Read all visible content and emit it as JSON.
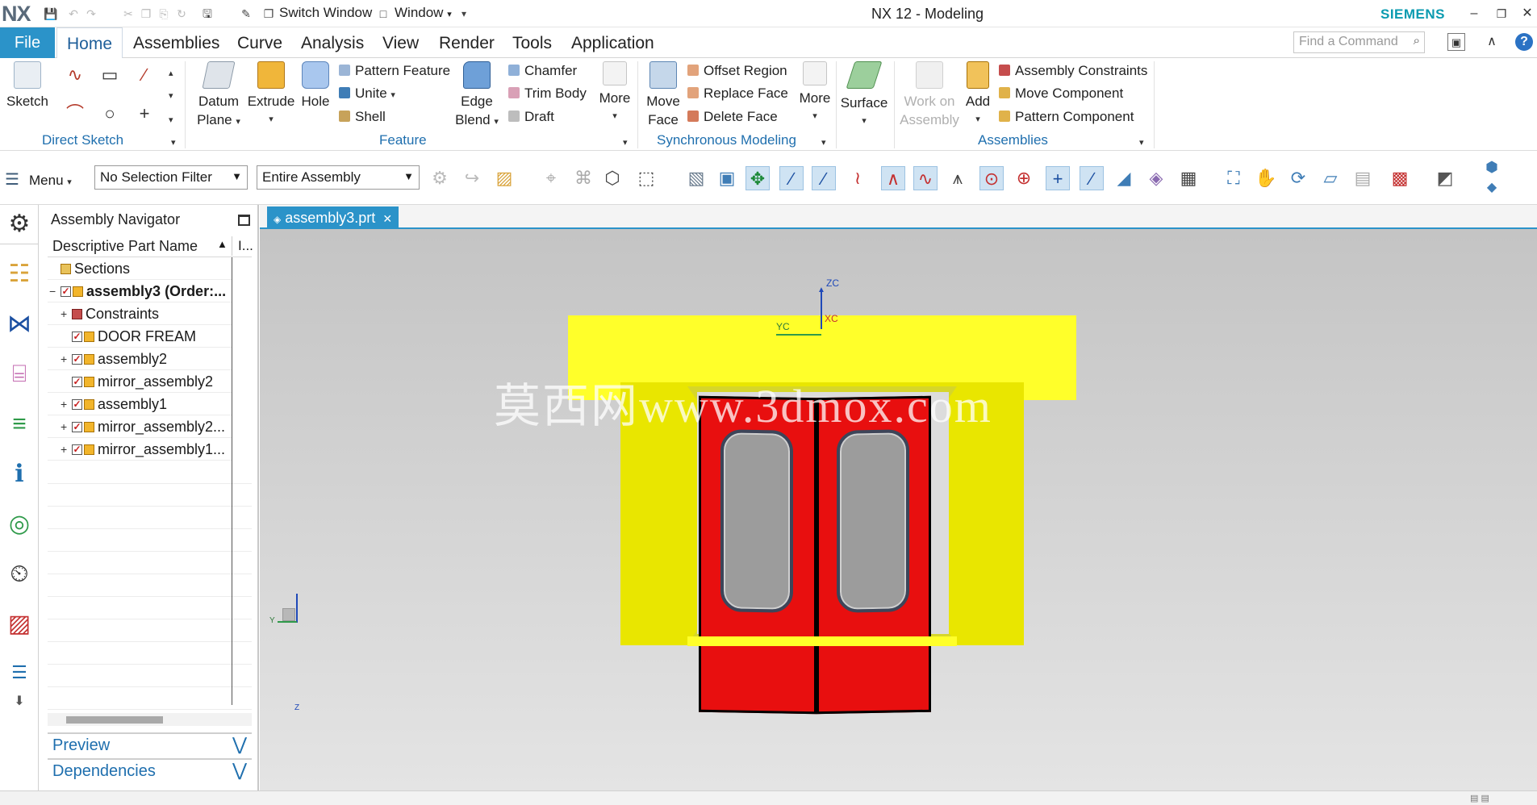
{
  "app": {
    "logo": "NX",
    "title": "NX 12 - Modeling",
    "brand": "SIEMENS",
    "switch_window": "Switch Window",
    "window_menu": "Window"
  },
  "menu": {
    "file": "File",
    "tabs": [
      "Home",
      "Assemblies",
      "Curve",
      "Analysis",
      "View",
      "Render",
      "Tools",
      "Application"
    ],
    "find_placeholder": "Find a Command"
  },
  "ribbon": {
    "direct_sketch": {
      "label": "Direct Sketch",
      "sketch": "Sketch"
    },
    "feature": {
      "label": "Feature",
      "datum_plane": [
        "Datum",
        "Plane"
      ],
      "extrude": "Extrude",
      "hole": "Hole",
      "pattern_feature": "Pattern Feature",
      "unite": "Unite",
      "shell": "Shell",
      "edge_blend": [
        "Edge",
        "Blend"
      ],
      "chamfer": "Chamfer",
      "trim_body": "Trim Body",
      "draft": "Draft",
      "more": "More"
    },
    "sync": {
      "label": "Synchronous Modeling",
      "move_face": [
        "Move",
        "Face"
      ],
      "offset_region": "Offset Region",
      "replace_face": "Replace Face",
      "delete_face": "Delete Face",
      "more": "More"
    },
    "surface": {
      "label": "Surface"
    },
    "assemblies": {
      "label": "Assemblies",
      "work_on_assembly": [
        "Work on",
        "Assembly"
      ],
      "add": "Add",
      "assembly_constraints": "Assembly Constraints",
      "move_component": "Move Component",
      "pattern_component": "Pattern Component"
    }
  },
  "selection_bar": {
    "menu": "Menu",
    "filter": "No Selection Filter",
    "scope": "Entire Assembly"
  },
  "navigator": {
    "title": "Assembly Navigator",
    "column": "Descriptive Part Name",
    "column2": "I...",
    "rows": [
      {
        "label": "Sections",
        "level": 0,
        "expander": "",
        "check": false
      },
      {
        "label": "assembly3 (Order:...",
        "level": 0,
        "expander": "−",
        "check": true,
        "bold": true
      },
      {
        "label": "Constraints",
        "level": 1,
        "expander": "+",
        "check": false
      },
      {
        "label": "DOOR FREAM",
        "level": 1,
        "expander": "",
        "check": true
      },
      {
        "label": "assembly2",
        "level": 1,
        "expander": "+",
        "check": true
      },
      {
        "label": "mirror_assembly2",
        "level": 1,
        "expander": "",
        "check": true
      },
      {
        "label": "assembly1",
        "level": 1,
        "expander": "+",
        "check": true
      },
      {
        "label": "mirror_assembly2...",
        "level": 1,
        "expander": "+",
        "check": true
      },
      {
        "label": "mirror_assembly1...",
        "level": 1,
        "expander": "+",
        "check": true
      }
    ],
    "preview": "Preview",
    "dependencies": "Dependencies"
  },
  "graphics": {
    "tab": "assembly3.prt",
    "watermark": "莫西网www.3dmox.com",
    "wcs": {
      "zc": "ZC",
      "yc": "YC",
      "xc": "XC"
    },
    "triad": {
      "z": "Z",
      "y": "Y"
    }
  },
  "colors": {
    "accent": "#2b93c9",
    "frame": "#ffff2a",
    "door": "#e80f0f"
  }
}
